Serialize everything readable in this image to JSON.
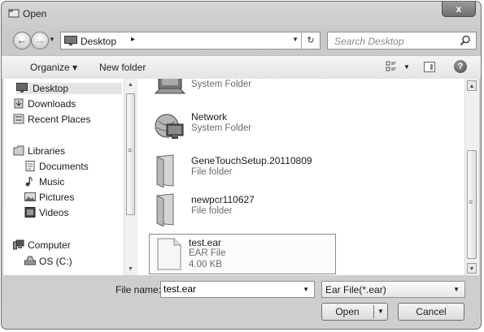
{
  "window": {
    "title": "Open",
    "close_label": "x"
  },
  "nav": {
    "address": {
      "current": "Desktop",
      "separator": "▸"
    },
    "search": {
      "placeholder": "Search Desktop"
    }
  },
  "toolbar": {
    "organize_label": "Organize ▾",
    "new_folder_label": "New folder"
  },
  "sidebar": {
    "items": [
      {
        "label": "Desktop",
        "icon": "desktop-icon"
      },
      {
        "label": "Downloads",
        "icon": "downloads-icon"
      },
      {
        "label": "Recent Places",
        "icon": "recent-places-icon"
      },
      {
        "label": "Libraries",
        "icon": "libraries-icon"
      },
      {
        "label": "Documents",
        "icon": "documents-icon"
      },
      {
        "label": "Music",
        "icon": "music-icon"
      },
      {
        "label": "Pictures",
        "icon": "pictures-icon"
      },
      {
        "label": "Videos",
        "icon": "videos-icon"
      },
      {
        "label": "Computer",
        "icon": "computer-icon"
      },
      {
        "label": "OS (C:)",
        "icon": "drive-icon"
      }
    ]
  },
  "files": {
    "items": [
      {
        "name": "",
        "type": "System Folder"
      },
      {
        "name": "Network",
        "type": "System Folder"
      },
      {
        "name": "GeneTouchSetup.20110809",
        "type": "File folder"
      },
      {
        "name": "newpcr110627",
        "type": "File folder"
      },
      {
        "name": "test.ear",
        "type": "EAR File",
        "size": "4.00 KB"
      }
    ]
  },
  "footer": {
    "file_name_label": "File name:",
    "file_name_value": "test.ear",
    "filter": "Ear File(*.ear)",
    "open_label": "Open",
    "cancel_label": "Cancel"
  }
}
